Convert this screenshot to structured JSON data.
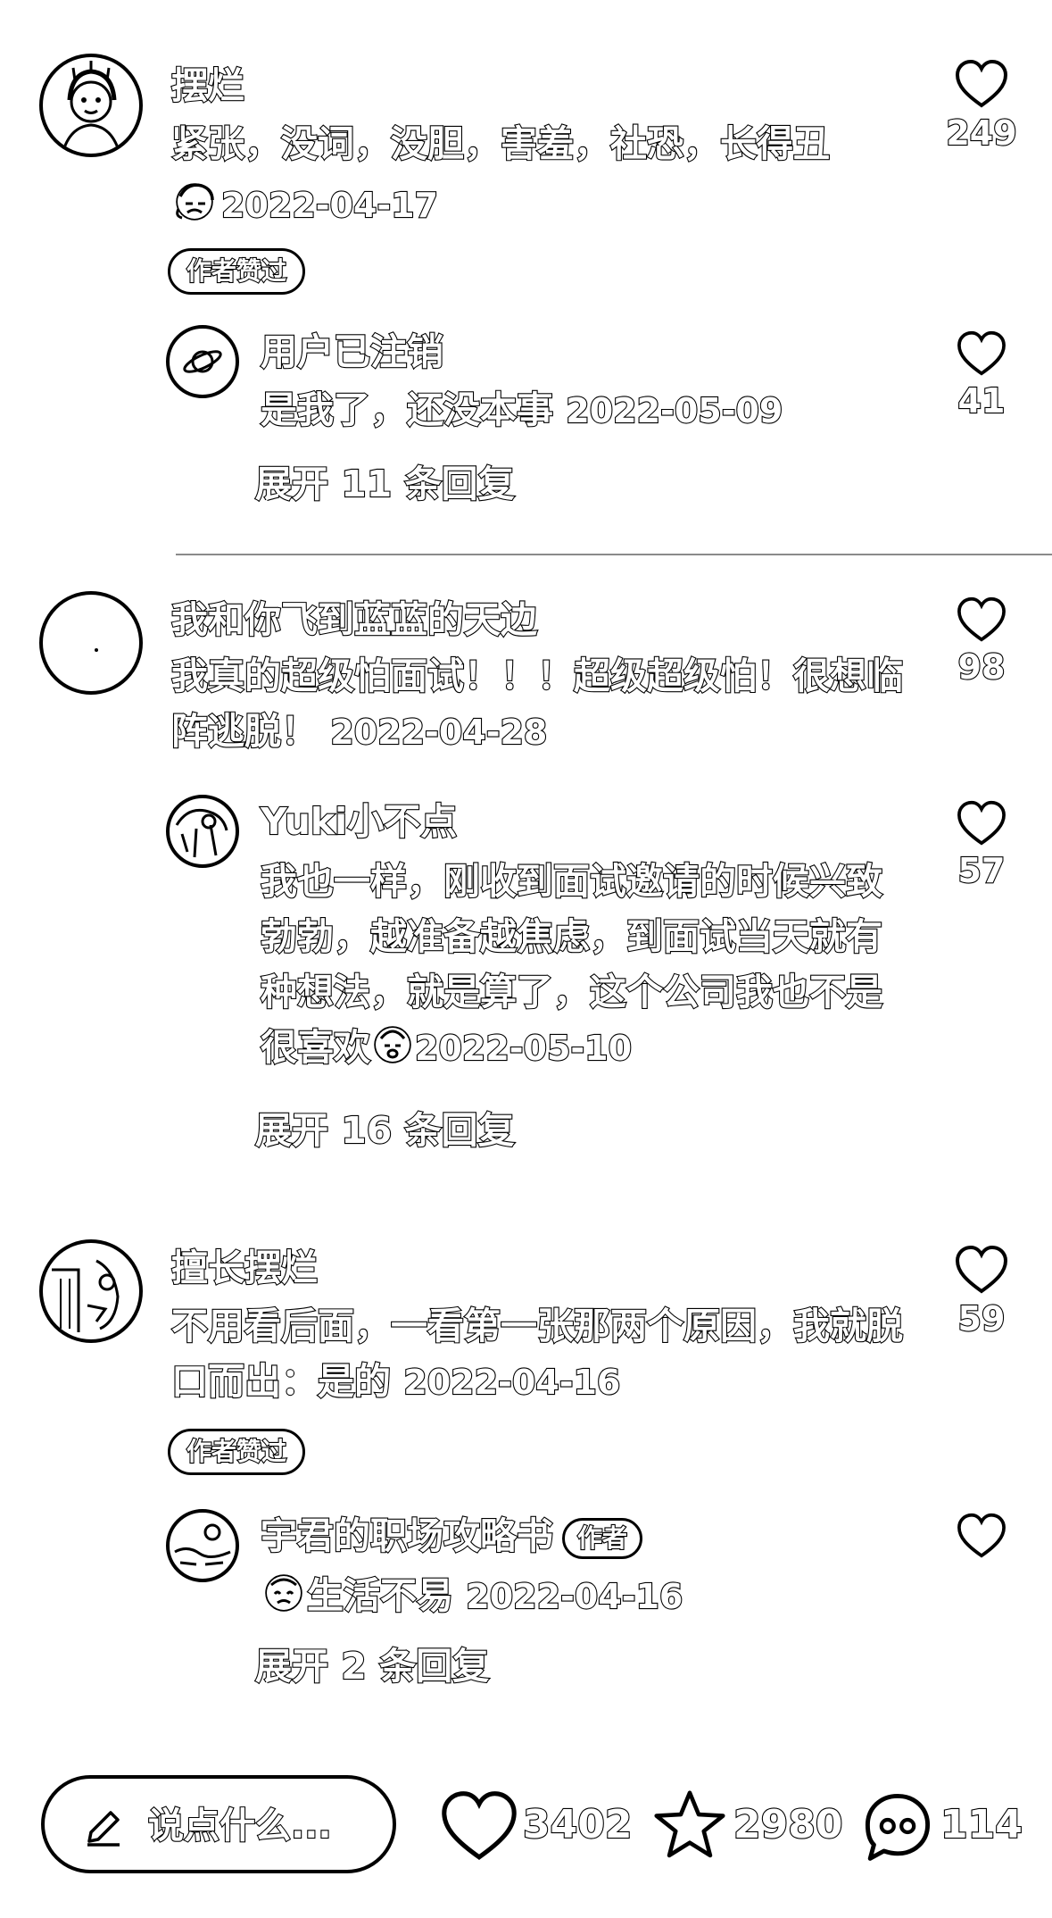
{
  "comments": [
    {
      "username": "摆烂",
      "text": "紧张，没词，没胆，害羞，社恐，长得丑",
      "date": "2022-04-17",
      "badge": "作者赞过",
      "likes": "249",
      "reply": {
        "username": "用户已注销",
        "text": "是我了，还没本事",
        "date": "2022-05-09",
        "likes": "41"
      },
      "expand": "展开 11 条回复"
    },
    {
      "username": "我和你飞到蓝蓝的天边",
      "text": "我真的超级怕面试！！！超级超级怕！很想临阵逃脱！",
      "date": "2022-04-28",
      "likes": "98",
      "reply": {
        "username": "Yuki小不点",
        "text": "我也一样，刚收到面试邀请的时候兴致勃勃，越准备越焦虑，到面试当天就有种想法，就是算了，这个公司我也不是很喜欢",
        "date": "2022-05-10",
        "likes": "57"
      },
      "expand": "展开 16 条回复"
    },
    {
      "username": "擅长摆烂",
      "text": "不用看后面，一看第一张那两个原因，我就脱口而出：是的",
      "date": "2022-04-16",
      "badge": "作者赞过",
      "likes": "59",
      "reply": {
        "username": "宇君的职场攻略书",
        "author_tag": "作者",
        "text": "生活不易",
        "date": "2022-04-16",
        "likes": ""
      },
      "expand": "展开 2 条回复"
    }
  ],
  "bottom_bar": {
    "placeholder": "说点什么...",
    "likes": "3402",
    "favorites": "2980",
    "comments": "114"
  },
  "icons": {
    "like": "heart-icon",
    "favorite": "star-icon",
    "comment": "chat-bubble-icon",
    "input": "pencil-icon"
  },
  "colors": {
    "text_fill": "#ffffff",
    "text_outline": "#000000",
    "divider": "#8a8a8a",
    "background": "#ffffff"
  }
}
